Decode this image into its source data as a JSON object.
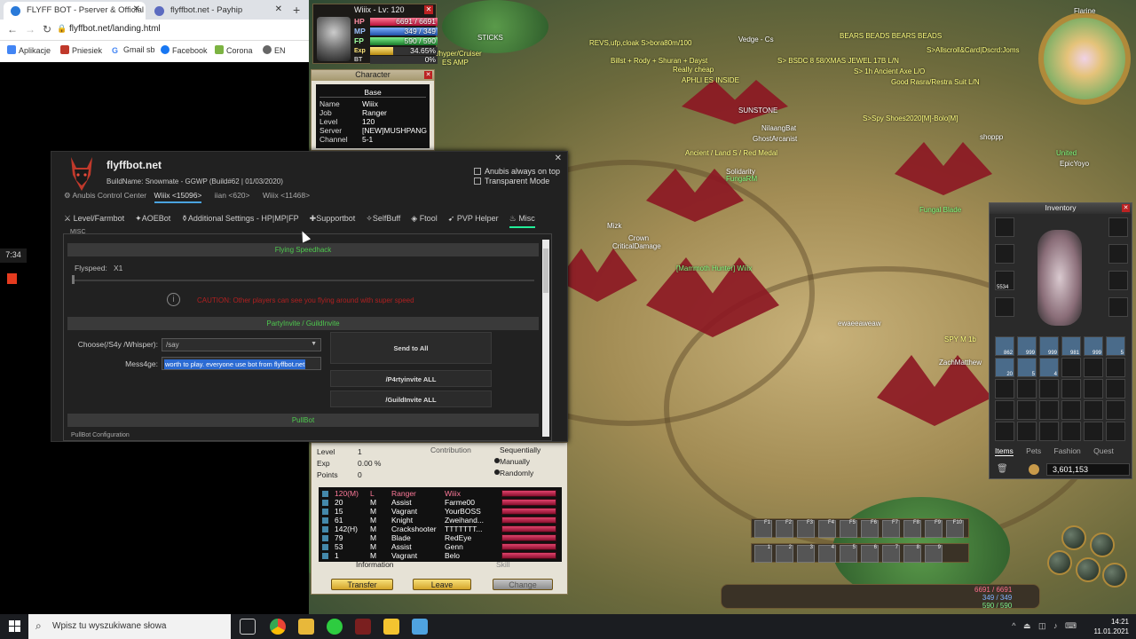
{
  "browser": {
    "tabs": [
      {
        "title": "FLYFF BOT - Pserver & Official Fly"
      },
      {
        "title": "flyffbot.net - Payhip"
      }
    ],
    "new_tab": "+",
    "url": "flyffbot.net/landing.html",
    "bookmarks": [
      "Aplikacje",
      "Pniesiek",
      "Gmail sb",
      "Facebook",
      "Corona",
      "EN"
    ]
  },
  "recorder": {
    "time": "7:34"
  },
  "game": {
    "status": {
      "title": "Wiiix - Lv: 120",
      "hp_label": "HP",
      "hp_value": "6691 / 6691",
      "hp_ratio": 1.0,
      "mp_label": "MP",
      "mp_value": "349 / 349",
      "mp_ratio": 1.0,
      "fp_label": "FP",
      "fp_value": "590 / 590",
      "fp_ratio": 1.0,
      "exp_label": "Exp",
      "exp_value": "34.65%",
      "exp_ratio": 0.3465,
      "bt_label": "BT",
      "bt_value": "0%"
    },
    "character": {
      "title": "Character",
      "base": "Base",
      "rows": [
        {
          "k": "Name",
          "v": "Wiiix"
        },
        {
          "k": "Job",
          "v": "Ranger"
        },
        {
          "k": "Level",
          "v": "120"
        },
        {
          "k": "Server",
          "v": "[NEW]MUSHPANG"
        },
        {
          "k": "Channel",
          "v": "5-1"
        }
      ]
    },
    "minimap": {
      "name": "Flarine"
    },
    "overlays": [
      "STICKS",
      "REVS,ufp,cloak S>bora80m/100",
      "Vedge - Cs",
      "BEARS BEADS BEARS BEADS",
      "S>Allscroll&Card|Dscrd:Joms",
      "Billst + Rody + Shuran + Dayst",
      "S> BSDC 8 58/XMAS JEWEL 17B L/N",
      "ES AMP",
      "Really cheap",
      "S> 1h Ancient Axe L/O",
      "APHLI ES INSIDE",
      "Good Rasra/Restra Suit L/N",
      "a/hyper/Cruiser",
      "S>Spy Shoes2020[M]-Bolo[M]",
      "SUNSTONE",
      "shoppp",
      "Ancient / Land S / Red Medal",
      "Solidarity",
      "FungaRM",
      "United",
      "Fungal Blade",
      "Crown",
      "CriticalDamage",
      "[Mammoth Hunter] Wiiix",
      "ewaeeaweaw",
      "SPY M 1b",
      "ZachMatthew",
      "EpicYoyo",
      "Mizk",
      "GhostArcanist",
      "NilaangBat"
    ],
    "inventory": {
      "title": "Inventory",
      "tabs": [
        "Items",
        "Pets",
        "Fashion",
        "Quest"
      ],
      "active_tab": "Items",
      "gold": "3,601,153",
      "counts": [
        "5534",
        "862",
        "999",
        "999",
        "981",
        "999",
        "5",
        "20",
        "5",
        "4"
      ]
    },
    "hotbar_keys": [
      "F1",
      "F2",
      "F3",
      "F4",
      "F5",
      "F6",
      "F7",
      "F8",
      "F9",
      "F10"
    ],
    "hotbar2_keys": [
      "1",
      "2",
      "3",
      "4",
      "5",
      "6",
      "7",
      "8",
      "9"
    ],
    "bottom_stats": [
      "6691 / 6691",
      "349 / 349",
      "590 / 590"
    ]
  },
  "bot": {
    "title": "flyffbot.net",
    "build": "BuildName: Snowmate - GGWP (Build#62 | 01/03/2020)",
    "subtitle": "Anubis Control Center",
    "clients": [
      "Wiiix <15096>",
      "iian <620>",
      "Wiiix <11468>"
    ],
    "close": "✕",
    "always_on_top": "Anubis always on top",
    "transparent": "Transparent Mode",
    "tabs": [
      "Level/Farmbot",
      "AOEBot",
      "Additional Settings - HP|MP|FP",
      "Supportbot",
      "SelfBuff",
      "Ftool",
      "PVP Helper",
      "Misc"
    ],
    "active_tab": "Misc",
    "misc_label": "MISC",
    "flying_header": "Flying Speedhack",
    "flyspeed_label": "Flyspeed:",
    "flyspeed_value": "X1",
    "flyspeed_ratio": 0.0,
    "caution": "CAUTION: Other players can see you flying around with super speed",
    "party_header": "PartyInvite / GuildInvite",
    "choose_label": "Choose(/S4y /Whisper):",
    "choose_value": "/say",
    "message_label": "Mess4ge:",
    "message_value": "worth to play. everyone use bot from flyffbot.net",
    "send_all": "Send to All",
    "party_all": "/P4rtyinvite ALL",
    "guild_all": "/GuildInvite ALL",
    "pull_header": "PullBot",
    "pull_config": "PullBot Configuration"
  },
  "party": {
    "level_label": "Level",
    "level_value": "1",
    "exp_label": "Exp",
    "exp_value": "0.00 %",
    "points_label": "Points",
    "points_value": "0",
    "contribution": "Contribution",
    "sequentially": "Sequentially",
    "manually": "Manually",
    "randomly": "Randomly",
    "members": [
      {
        "lv": "120(M)",
        "g": "L",
        "job": "Ranger",
        "name": "Wiiix"
      },
      {
        "lv": "20",
        "g": "M",
        "job": "Assist",
        "name": "Farme00"
      },
      {
        "lv": "15",
        "g": "M",
        "job": "Vagrant",
        "name": "YourBOSS"
      },
      {
        "lv": "61",
        "g": "M",
        "job": "Knight",
        "name": "Zweihand..."
      },
      {
        "lv": "142(H)",
        "g": "M",
        "job": "Crackshooter",
        "name": "TTTTTTT..."
      },
      {
        "lv": "79",
        "g": "M",
        "job": "Blade",
        "name": "RedEye"
      },
      {
        "lv": "53",
        "g": "M",
        "job": "Assist",
        "name": "Genn"
      },
      {
        "lv": "1",
        "g": "M",
        "job": "Vagrant",
        "name": "Belo"
      }
    ],
    "information": "Information",
    "skill": "Skill",
    "transfer": "Transfer",
    "leave": "Leave",
    "change": "Change"
  },
  "taskbar": {
    "search_placeholder": "Wpisz tu wyszukiwane słowa",
    "time": "14:21",
    "date": "11.01.2021"
  },
  "colors": {
    "accent": "#2e9e5e",
    "hp": "#e0436c",
    "mp": "#3b7bd6",
    "fp": "#3bb55a",
    "caution": "#b02020",
    "selection": "#2b6bd3"
  }
}
